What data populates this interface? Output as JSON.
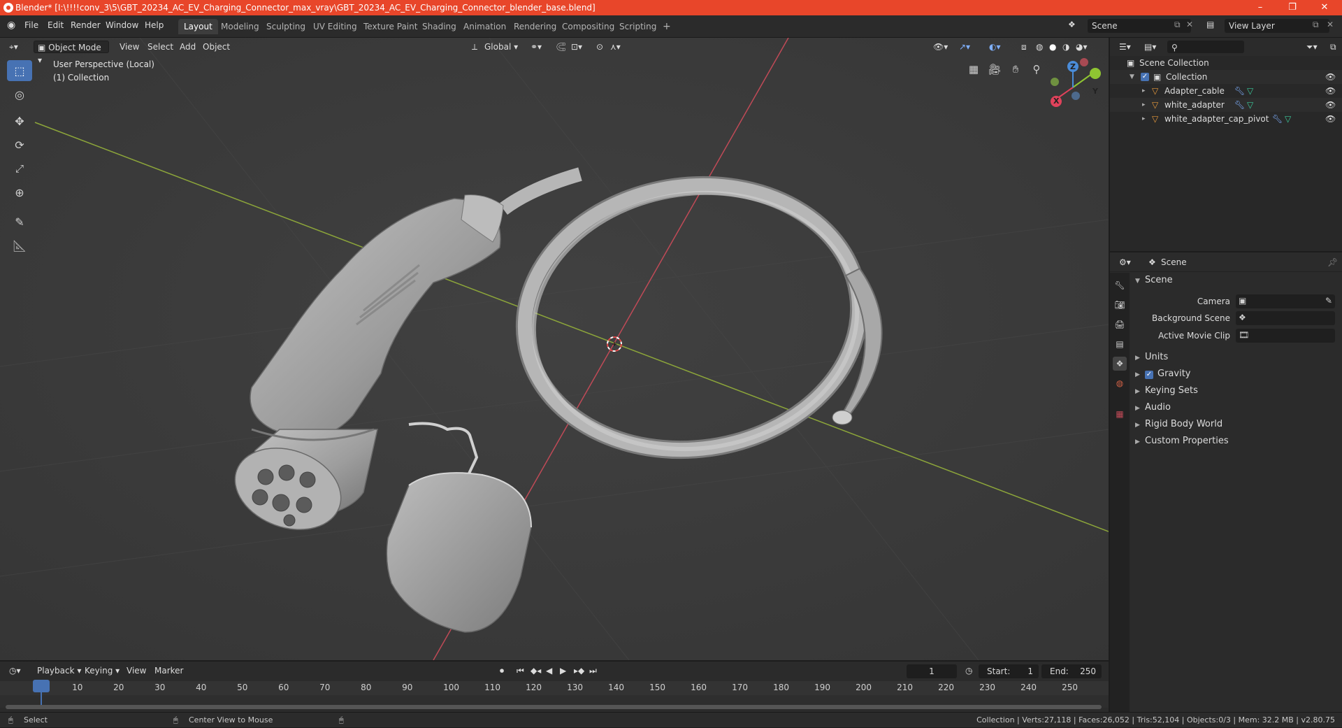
{
  "window": {
    "title": "Blender* [I:\\!!!!conv_3\\5\\GBT_20234_AC_EV_Charging_Connector_max_vray\\GBT_20234_AC_EV_Charging_Connector_blender_base.blend]",
    "minimize": "–",
    "maximize": "❐",
    "close": "✕"
  },
  "menu": {
    "file": "File",
    "edit": "Edit",
    "render": "Render",
    "window": "Window",
    "help": "Help"
  },
  "workspaces": [
    "Layout",
    "Modeling",
    "Sculpting",
    "UV Editing",
    "Texture Paint",
    "Shading",
    "Animation",
    "Rendering",
    "Compositing",
    "Scripting"
  ],
  "add_workspace": "+",
  "scene_field": "Scene",
  "view_layer_field": "View Layer",
  "viewport": {
    "mode": "Object Mode",
    "view": "View",
    "select": "Select",
    "add": "Add",
    "object": "Object",
    "orientation": "Global",
    "perspective": "User Perspective (Local)",
    "collection": "(1) Collection",
    "gizmo": {
      "x": "X",
      "y": "Y",
      "z": "Z"
    }
  },
  "outliner": {
    "root": "Scene Collection",
    "collection": "Collection",
    "objects": [
      "Adapter_cable",
      "white_adapter",
      "white_adapter_cap_pivot"
    ]
  },
  "properties": {
    "context": "Scene",
    "section": "Scene",
    "camera_label": "Camera",
    "background_label": "Background Scene",
    "clip_label": "Active Movie Clip",
    "panels": [
      "Units",
      "Gravity",
      "Keying Sets",
      "Audio",
      "Rigid Body World",
      "Custom Properties"
    ],
    "gravity_enabled": true
  },
  "timeline": {
    "playback": "Playback",
    "keying": "Keying",
    "view": "View",
    "marker": "Marker",
    "current_frame": "1",
    "start_label": "Start:",
    "start": "1",
    "end_label": "End:",
    "end": "250",
    "ticks": [
      "1",
      "10",
      "20",
      "30",
      "40",
      "50",
      "60",
      "70",
      "80",
      "90",
      "100",
      "110",
      "120",
      "130",
      "140",
      "150",
      "160",
      "170",
      "180",
      "190",
      "200",
      "210",
      "220",
      "230",
      "240",
      "250"
    ]
  },
  "status": {
    "select": "Select",
    "center": "Center View to Mouse",
    "stats": "Collection | Verts:27,118 | Faces:26,052 | Tris:52,104 | Objects:0/3 | Mem: 32.2 MB | v2.80.75"
  }
}
